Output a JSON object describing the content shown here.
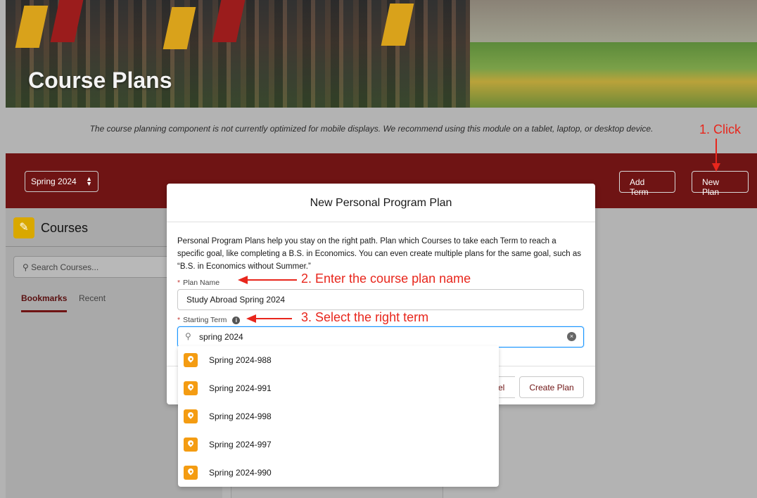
{
  "hero": {
    "title": "Course Plans"
  },
  "notice": "The course planning component is not currently optimized for mobile displays. We recommend using this module on a tablet, laptop, or desktop device.",
  "toolbar": {
    "term_value": "Spring 2024",
    "add_term_label": "Add Term",
    "new_plan_label": "New Plan"
  },
  "courses_panel": {
    "title": "Courses",
    "search_placeholder": "Search Courses...",
    "tabs": [
      "Bookmarks",
      "Recent"
    ]
  },
  "modal": {
    "title": "New Personal Program Plan",
    "description": "Personal Program Plans help you stay on the right path. Plan which Courses to take each Term to reach a specific goal, like completing a B.S. in Economics. You can even create multiple plans for the same goal, such as “B.S. in Economics without Summer.”",
    "plan_name_label": "Plan Name",
    "plan_name_value": "Study Abroad Spring 2024",
    "starting_term_label": "Starting Term",
    "starting_term_search": "spring 2024",
    "cancel_label_partial": "el",
    "create_label": "Create Plan"
  },
  "dropdown": {
    "options": [
      "Spring 2024-988",
      "Spring 2024-991",
      "Spring 2024-998",
      "Spring 2024-997",
      "Spring 2024-990"
    ]
  },
  "annotations": {
    "step1": "1. Click",
    "step2": "2. Enter the course plan name",
    "step3": "3. Select the right term"
  },
  "colors": {
    "brand_red": "#6f1414",
    "annotation_red": "#e8261c",
    "option_icon": "#f49c12",
    "focus_blue": "#1b96ff"
  }
}
